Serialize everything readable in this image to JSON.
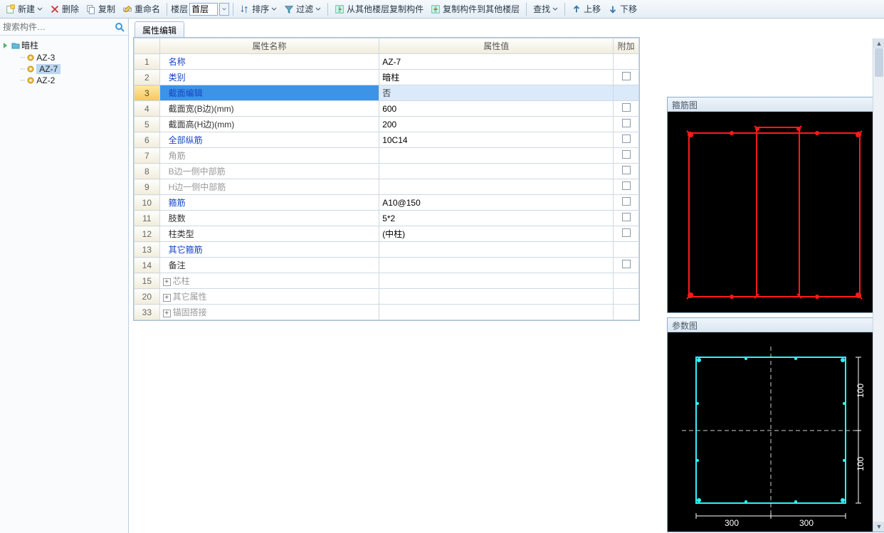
{
  "toolbar": {
    "new": "新建",
    "delete": "删除",
    "copy": "复制",
    "rename": "重命名",
    "floor_lbl": "楼层",
    "floor_sel": "首层",
    "sort": "排序",
    "filter": "过滤",
    "copy_from_other": "从其他楼层复制构件",
    "copy_to_other": "复制构件到其他楼层",
    "find": "查找",
    "move_up": "上移",
    "move_down": "下移"
  },
  "search_placeholder": "搜索构件…",
  "tree": {
    "root": "暗柱",
    "items": [
      "AZ-3",
      "AZ-7",
      "AZ-2"
    ],
    "selected": 1
  },
  "tab_label": "属性编辑",
  "headers": {
    "name": "属性名称",
    "value": "属性值",
    "extra": "附加"
  },
  "rows": [
    {
      "n": "1",
      "name": "名称",
      "val": "AZ-7",
      "cls": "link",
      "chk": false
    },
    {
      "n": "2",
      "name": "类别",
      "val": "暗柱",
      "cls": "link",
      "chk": true
    },
    {
      "n": "3",
      "name": "截面编辑",
      "val": "否",
      "cls": "link",
      "chk": false,
      "sel": true
    },
    {
      "n": "4",
      "name": "截面宽(B边)(mm)",
      "val": "600",
      "cls": "",
      "chk": true
    },
    {
      "n": "5",
      "name": "截面高(H边)(mm)",
      "val": "200",
      "cls": "",
      "chk": true
    },
    {
      "n": "6",
      "name": "全部纵筋",
      "val": "10C14",
      "cls": "link",
      "chk": true
    },
    {
      "n": "7",
      "name": "角筋",
      "val": "",
      "cls": "gray",
      "chk": true
    },
    {
      "n": "8",
      "name": "B边一侧中部筋",
      "val": "",
      "cls": "gray",
      "chk": true
    },
    {
      "n": "9",
      "name": "H边一侧中部筋",
      "val": "",
      "cls": "gray",
      "chk": true
    },
    {
      "n": "10",
      "name": "箍筋",
      "val": "A10@150",
      "cls": "link",
      "chk": true
    },
    {
      "n": "11",
      "name": "肢数",
      "val": "5*2",
      "cls": "",
      "chk": true
    },
    {
      "n": "12",
      "name": "柱类型",
      "val": "(中柱)",
      "cls": "",
      "chk": true
    },
    {
      "n": "13",
      "name": "其它箍筋",
      "val": "",
      "cls": "link",
      "chk": false
    },
    {
      "n": "14",
      "name": "备注",
      "val": "",
      "cls": "",
      "chk": true
    },
    {
      "n": "15",
      "name": "芯柱",
      "val": "",
      "cls": "gray",
      "chk": false,
      "exp": true
    },
    {
      "n": "20",
      "name": "其它属性",
      "val": "",
      "cls": "gray",
      "chk": false,
      "exp": true
    },
    {
      "n": "33",
      "name": "锚固搭接",
      "val": "",
      "cls": "gray",
      "chk": false,
      "exp": true
    }
  ],
  "panels": {
    "stirrup": "箍筋图",
    "param": "参数图"
  },
  "param_dims": {
    "w_left": "300",
    "w_right": "300",
    "h_top": "100",
    "h_bot": "100"
  }
}
